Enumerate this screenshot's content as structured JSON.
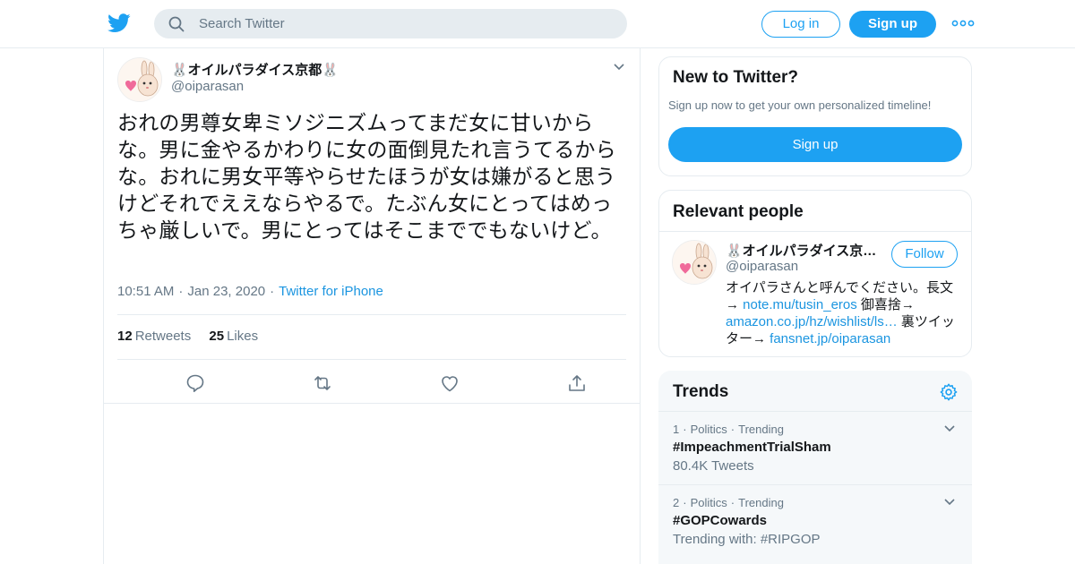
{
  "header": {
    "search_placeholder": "Search Twitter",
    "login_label": "Log in",
    "signup_label": "Sign up",
    "brand_color": "#1da1f2"
  },
  "tweet": {
    "author_name": "🐰オイルパラダイス京都🐰",
    "author_handle": "@oiparasan",
    "text": "おれの男尊女卑ミソジニズムってまだ女に甘いからな。男に金やるかわりに女の面倒見たれ言うてるからな。おれに男女平等やらせたほうが女は嫌がると思うけどそれでええならやるで。たぶん女にとってはめっちゃ厳しいで。男にとってはそこまででもないけど。",
    "time": "10:51 AM",
    "date": "Jan 23, 2020",
    "source": "Twitter for iPhone",
    "retweets_count": "12",
    "retweets_label": "Retweets",
    "likes_count": "25",
    "likes_label": "Likes"
  },
  "sidebar": {
    "new_to_twitter": {
      "title": "New to Twitter?",
      "subtitle": "Sign up now to get your own personalized timeline!",
      "button": "Sign up"
    },
    "relevant_people": {
      "title": "Relevant people",
      "name": "🐰オイルパラダイス京都🐰",
      "handle": "@oiparasan",
      "follow_label": "Follow",
      "bio_1": "オイパラさんと呼んでください。長文→ ",
      "bio_link_1": "note.mu/tusin_eros",
      "bio_2": " 御喜捨→ ",
      "bio_link_2": "amazon.co.jp/hz/wishlist/ls…",
      "bio_3": " 裏ツイッター→ ",
      "bio_link_3": "fansnet.jp/oiparasan"
    },
    "trends": {
      "title": "Trends",
      "items": [
        {
          "rank": "1",
          "category": "Politics",
          "status": "Trending",
          "name": "#ImpeachmentTrialSham",
          "sub": "80.4K Tweets"
        },
        {
          "rank": "2",
          "category": "Politics",
          "status": "Trending",
          "name": "#GOPCowards",
          "sub": "Trending with: #RIPGOP"
        }
      ]
    }
  }
}
